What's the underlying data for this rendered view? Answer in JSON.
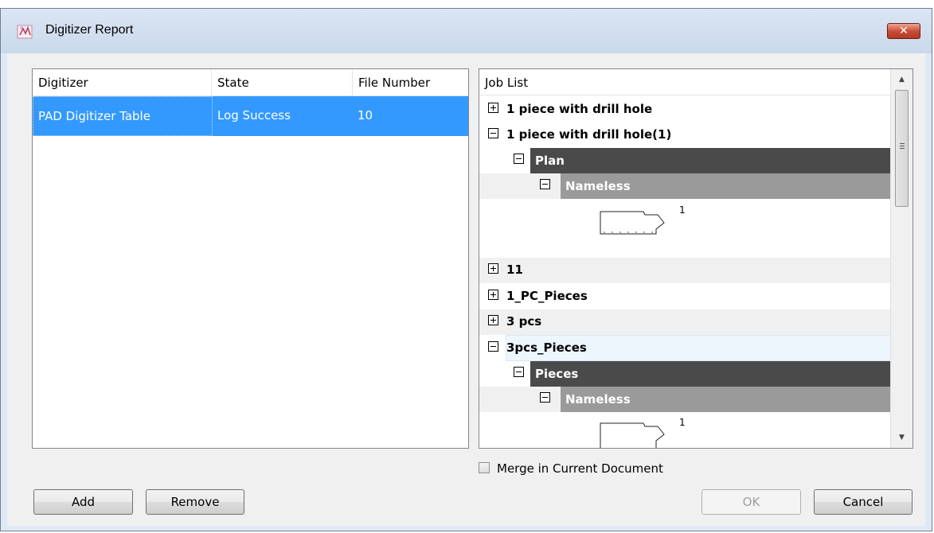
{
  "window": {
    "title": "Digitizer Report",
    "close_symbol": "✕"
  },
  "digitizer_table": {
    "columns": [
      "Digitizer",
      "State",
      "File Number"
    ],
    "rows": [
      {
        "digitizer": "PAD Digitizer Table",
        "state": "Log Success",
        "file_number": "10"
      }
    ]
  },
  "job_list": {
    "header": "Job List",
    "items": [
      {
        "label": "1 piece with drill hole",
        "expanded": false
      },
      {
        "label": "1 piece with drill hole(1)",
        "expanded": true,
        "children": [
          {
            "label": "Plan",
            "children": [
              {
                "label": "Nameless",
                "piece_thumbnails": [
                  "1"
                ]
              }
            ]
          }
        ]
      },
      {
        "label": "11",
        "expanded": false
      },
      {
        "label": "1_PC_Pieces",
        "expanded": false
      },
      {
        "label": "3 pcs",
        "expanded": false
      },
      {
        "label": "3pcs_Pieces",
        "expanded": true,
        "children": [
          {
            "label": "Pieces",
            "children": [
              {
                "label": "Nameless",
                "piece_thumbnails": [
                  "1"
                ]
              }
            ]
          }
        ]
      }
    ]
  },
  "options": {
    "merge_label": "Merge in Current Document",
    "merge_checked": false
  },
  "buttons": {
    "add": "Add",
    "remove": "Remove",
    "ok": "OK",
    "cancel": "Cancel"
  },
  "colors": {
    "selection": "#3399ff",
    "plan_bar": "#4a4a4a",
    "nameless_bar": "#9a9a9a",
    "close_button": "#c74a33"
  }
}
